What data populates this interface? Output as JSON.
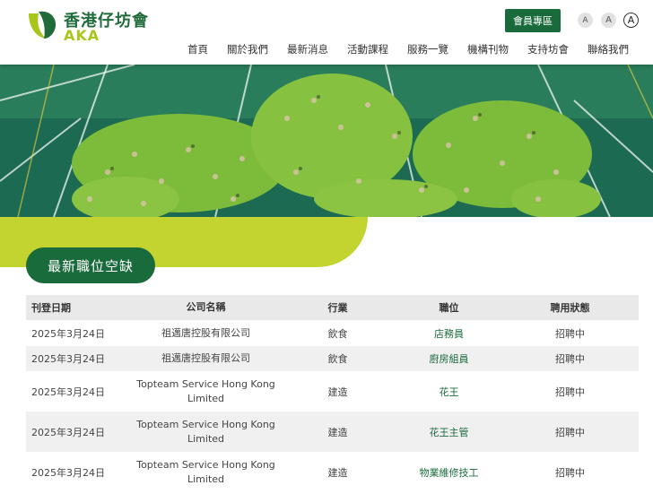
{
  "brand": {
    "name_cn": "香港仔坊會",
    "name_en": "AKA",
    "colors": {
      "primary": "#1a6b3c",
      "accent": "#c3d430"
    }
  },
  "header": {
    "member_button": "會員專區",
    "font_sizes": [
      "A",
      "A",
      "A"
    ],
    "nav": [
      "首頁",
      "關於我們",
      "最新消息",
      "活動課程",
      "服務一覽",
      "機構刊物",
      "支持坊會",
      "聯絡我們"
    ]
  },
  "section": {
    "title": "最新職位空缺"
  },
  "table": {
    "headers": [
      "刊登日期",
      "公司名稱",
      "行業",
      "職位",
      "聘用狀態"
    ],
    "rows": [
      {
        "date": "2025年3月24日",
        "company": "祖邁唐控股有限公司",
        "industry": "飲食",
        "position": "店務員",
        "status": "招聘中"
      },
      {
        "date": "2025年3月24日",
        "company": "祖邁唐控股有限公司",
        "industry": "飲食",
        "position": "廚房組員",
        "status": "招聘中"
      },
      {
        "date": "2025年3月24日",
        "company": "Topteam Service Hong Kong Limited",
        "industry": "建造",
        "position": "花王",
        "status": "招聘中"
      },
      {
        "date": "2025年3月24日",
        "company": "Topteam Service Hong Kong Limited",
        "industry": "建造",
        "position": "花王主管",
        "status": "招聘中"
      },
      {
        "date": "2025年3月24日",
        "company": "Topteam Service Hong Kong Limited",
        "industry": "建造",
        "position": "物業維修技工",
        "status": "招聘中"
      }
    ]
  }
}
